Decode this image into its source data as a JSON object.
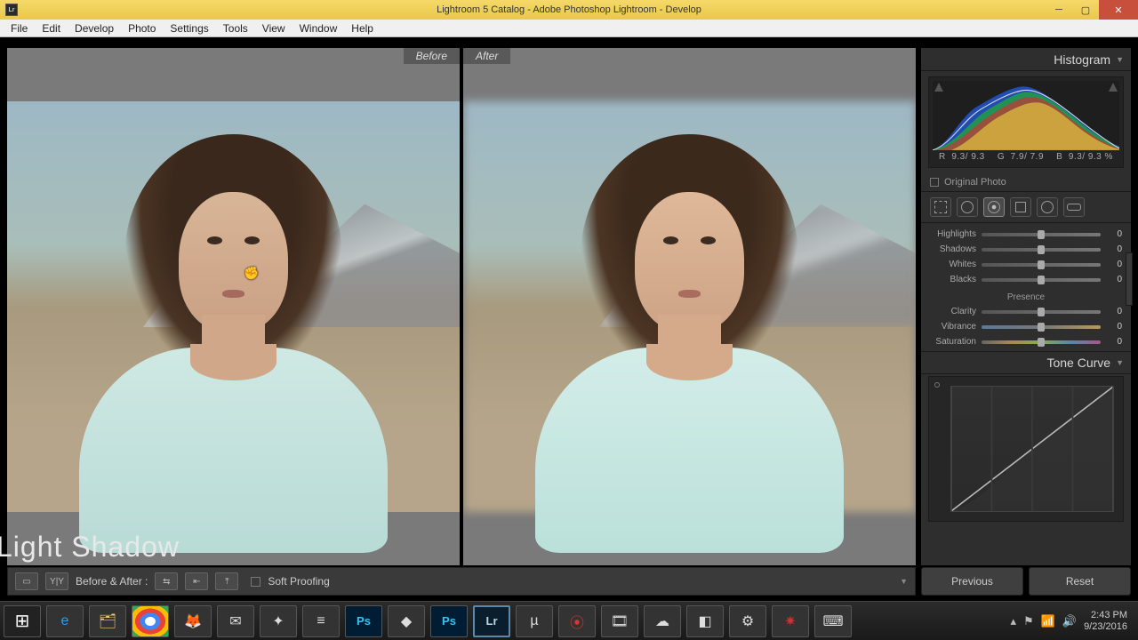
{
  "titlebar": {
    "title": "Lightroom 5 Catalog - Adobe Photoshop Lightroom - Develop",
    "icon_label": "Lr"
  },
  "menu": [
    "File",
    "Edit",
    "Develop",
    "Photo",
    "Settings",
    "Tools",
    "View",
    "Window",
    "Help"
  ],
  "compare": {
    "before": "Before",
    "after": "After",
    "watermark": "Light Shadow"
  },
  "histogram": {
    "title": "Histogram",
    "rgb": {
      "r_label": "R",
      "r1": "9.3",
      "r2": "9.3",
      "g_label": "G",
      "g1": "7.9",
      "g2": "7.9",
      "b_label": "B",
      "b1": "9.3",
      "b2": "9.3",
      "pct": "%"
    },
    "original_photo": "Original Photo"
  },
  "sliders": {
    "rows": [
      {
        "label": "Highlights",
        "value": "0"
      },
      {
        "label": "Shadows",
        "value": "0"
      },
      {
        "label": "Whites",
        "value": "0"
      },
      {
        "label": "Blacks",
        "value": "0"
      }
    ],
    "presence_header": "Presence",
    "presence": [
      {
        "label": "Clarity",
        "value": "0"
      },
      {
        "label": "Vibrance",
        "value": "0"
      },
      {
        "label": "Saturation",
        "value": "0"
      }
    ]
  },
  "tonecurve": {
    "title": "Tone Curve"
  },
  "bottombar": {
    "before_after": "Before & After :",
    "soft_proofing": "Soft Proofing"
  },
  "rbuttons": {
    "previous": "Previous",
    "reset": "Reset"
  },
  "taskbar": {
    "items": [
      {
        "name": "start",
        "glyph": "⊞"
      },
      {
        "name": "ie",
        "glyph": "e"
      },
      {
        "name": "explorer",
        "glyph": "🗂"
      },
      {
        "name": "chrome",
        "glyph": ""
      },
      {
        "name": "firefox",
        "glyph": "🦊"
      },
      {
        "name": "thunderbird",
        "glyph": "✉"
      },
      {
        "name": "app1",
        "glyph": "✦"
      },
      {
        "name": "app2",
        "glyph": "≡"
      },
      {
        "name": "ps",
        "glyph": "Ps"
      },
      {
        "name": "app3",
        "glyph": "◆"
      },
      {
        "name": "ps2",
        "glyph": "Ps"
      },
      {
        "name": "lr",
        "glyph": "Lr"
      },
      {
        "name": "utorrent",
        "glyph": "µ"
      },
      {
        "name": "record",
        "glyph": "⦿"
      },
      {
        "name": "video",
        "glyph": "🎞"
      },
      {
        "name": "app4",
        "glyph": "☁"
      },
      {
        "name": "app5",
        "glyph": "◧"
      },
      {
        "name": "app6",
        "glyph": "⚙"
      },
      {
        "name": "app7",
        "glyph": "✷"
      },
      {
        "name": "keyboard",
        "glyph": "⌨"
      }
    ],
    "clock_time": "2:43 PM",
    "clock_date": "9/23/2016"
  }
}
